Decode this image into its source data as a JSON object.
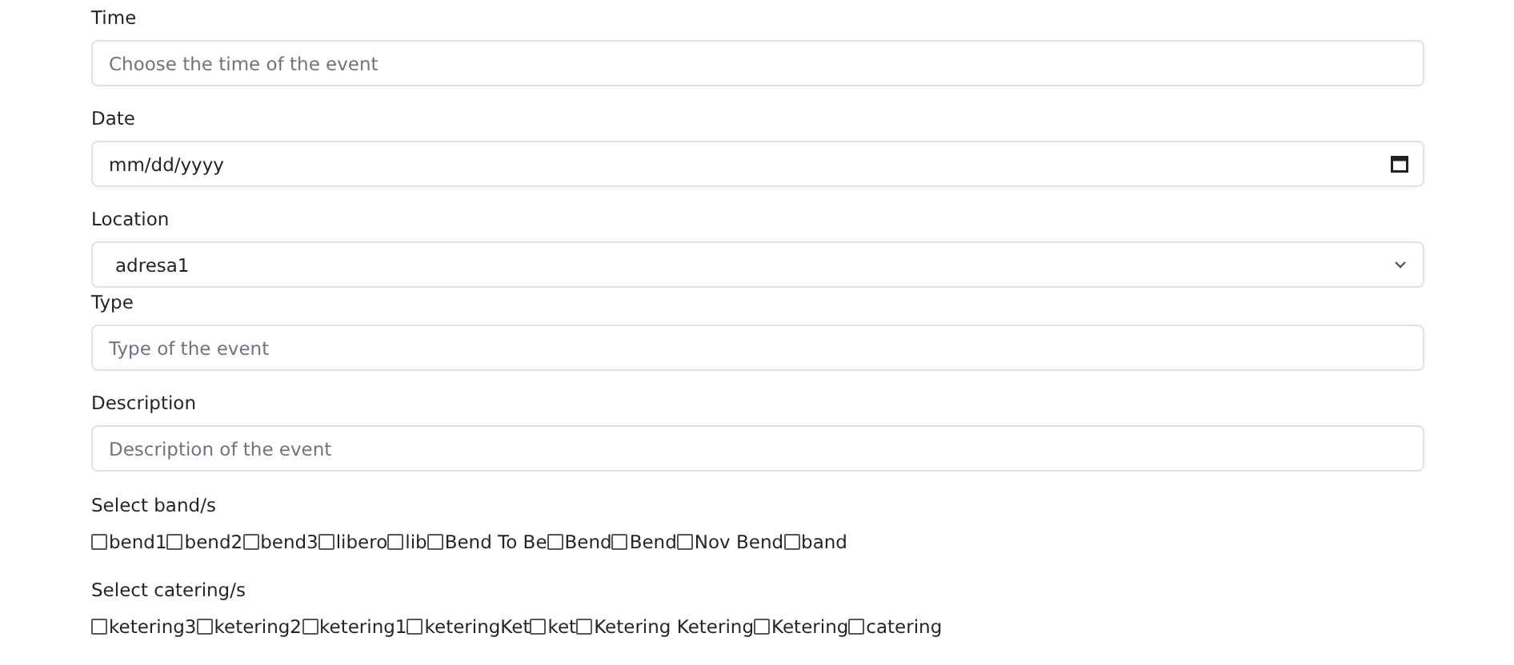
{
  "fields": [
    {
      "kind": "text",
      "label": "Time",
      "placeholder": "Choose the time of the event"
    },
    {
      "kind": "date",
      "label": "Date",
      "placeholder": "mm/dd/yyyy"
    },
    {
      "kind": "select",
      "label": "Location",
      "value": "adresa1"
    },
    {
      "kind": "text",
      "label": "Type",
      "placeholder": "Type of the event"
    },
    {
      "kind": "text",
      "label": "Description",
      "placeholder": "Description of the event"
    }
  ],
  "checkbox_groups": [
    {
      "label": "Select band/s",
      "options": [
        {
          "label": "bend1",
          "checked": false
        },
        {
          "label": "bend2",
          "checked": false
        },
        {
          "label": "bend3",
          "checked": false
        },
        {
          "label": "libero",
          "checked": false
        },
        {
          "label": "lib",
          "checked": false
        },
        {
          "label": "Bend To Be",
          "checked": false
        },
        {
          "label": "Bend",
          "checked": false
        },
        {
          "label": "Bend",
          "checked": false
        },
        {
          "label": "Nov Bend",
          "checked": false
        },
        {
          "label": "band",
          "checked": false
        }
      ]
    },
    {
      "label": "Select catering/s",
      "options": [
        {
          "label": "ketering3",
          "checked": false
        },
        {
          "label": "ketering2",
          "checked": false
        },
        {
          "label": "ketering1",
          "checked": false
        },
        {
          "label": "keteringKet",
          "checked": false
        },
        {
          "label": "ket",
          "checked": false
        },
        {
          "label": "Ketering Ketering",
          "checked": false
        },
        {
          "label": "Ketering",
          "checked": false
        },
        {
          "label": "catering",
          "checked": false
        }
      ]
    }
  ]
}
